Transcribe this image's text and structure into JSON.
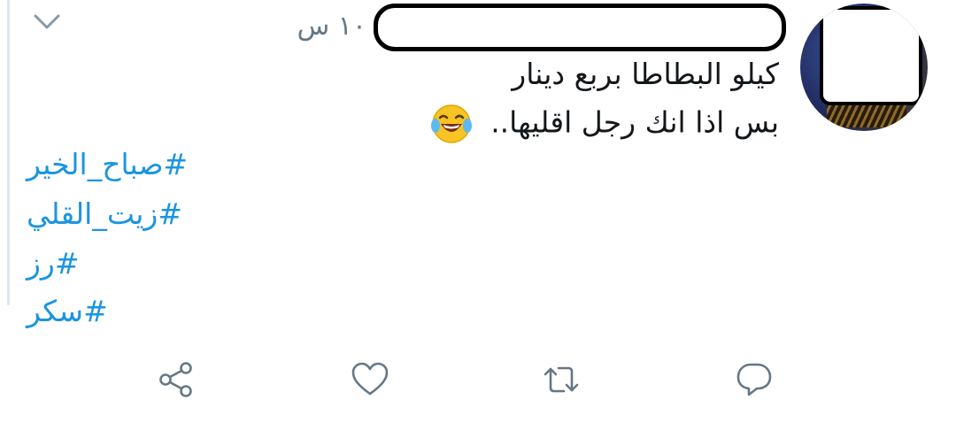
{
  "tweet": {
    "timestamp": "١٠ س",
    "text_lines": [
      "كيلو البطاطا بربع دينار",
      "بس اذا انك رجل اقليها.."
    ],
    "emoji": "face-with-tears-of-joy",
    "hashtags": [
      "#صباح_الخير",
      "#زيت_القلي",
      "#رز",
      "#سكر"
    ]
  },
  "colors": {
    "hashtag": "#1b95e0",
    "text": "#14171a",
    "muted": "#657786",
    "icon": "#657786"
  },
  "icons": {
    "menu": "chevron-down-icon",
    "actions": [
      "share-icon",
      "like-icon",
      "retweet-icon",
      "reply-icon"
    ]
  }
}
